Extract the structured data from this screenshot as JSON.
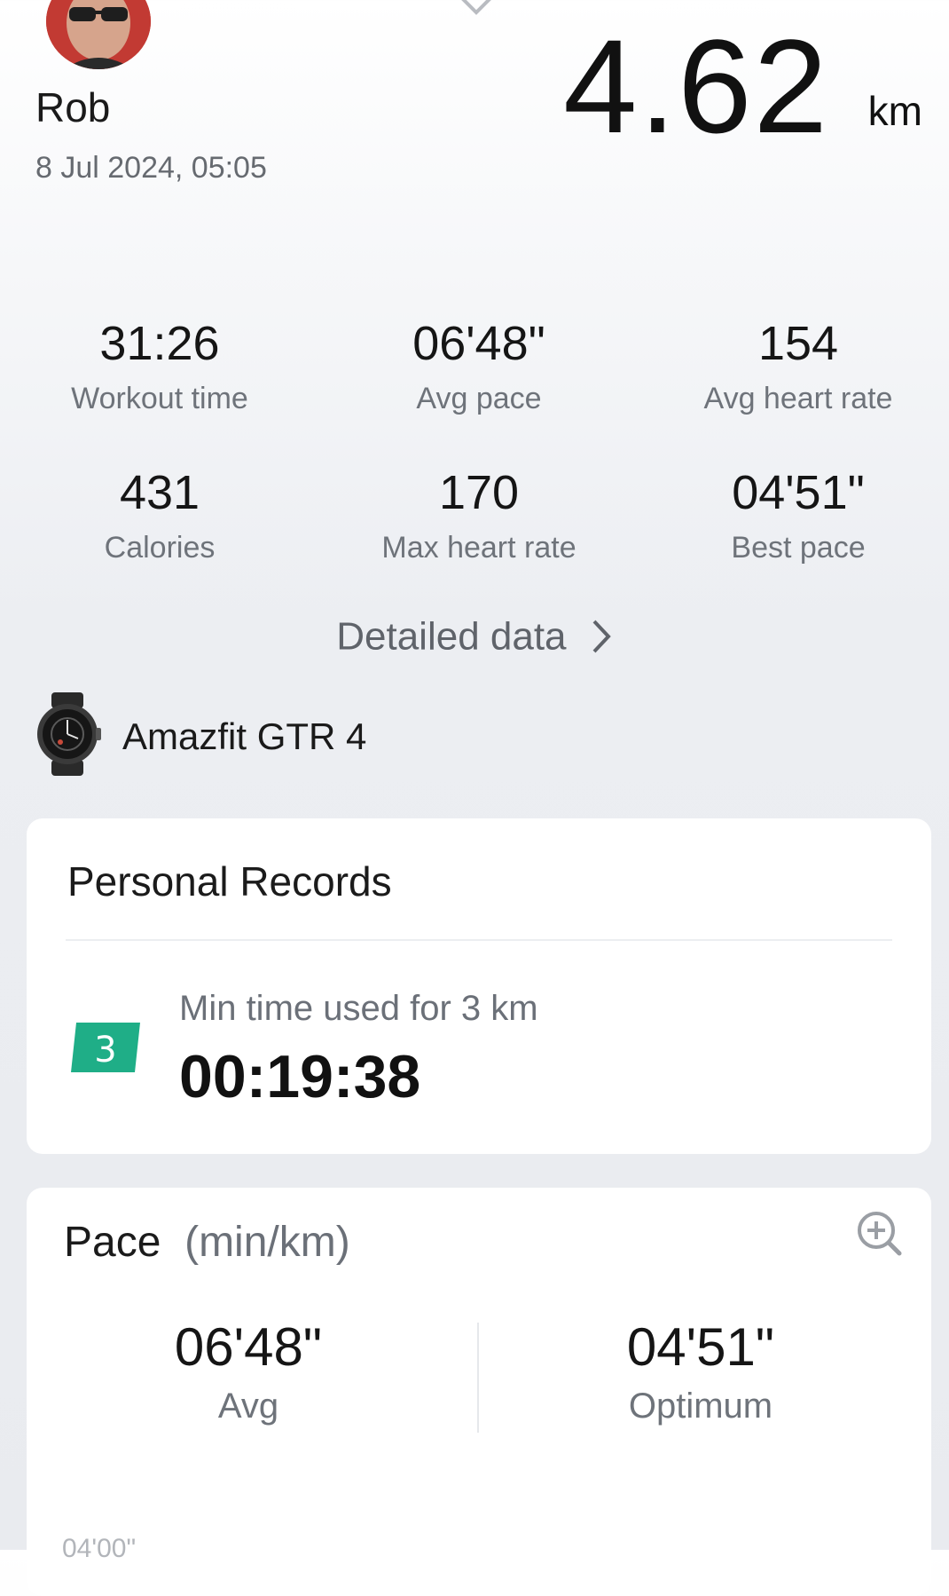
{
  "header": {
    "user_name": "Rob",
    "date": "8 Jul 2024, 05:05",
    "distance": "4.62",
    "distance_unit": "km"
  },
  "stats": [
    {
      "value": "31:26",
      "label": "Workout time"
    },
    {
      "value": "06'48\"",
      "label": "Avg pace"
    },
    {
      "value": "154",
      "label": "Avg heart rate"
    },
    {
      "value": "431",
      "label": "Calories"
    },
    {
      "value": "170",
      "label": "Max heart rate"
    },
    {
      "value": "04'51\"",
      "label": "Best pace"
    }
  ],
  "detailed_link": "Detailed data",
  "device": {
    "name": "Amazfit GTR 4"
  },
  "records": {
    "title": "Personal Records",
    "badge": "3",
    "label": "Min time used for 3 km",
    "value": "00:19:38"
  },
  "pace": {
    "title": "Pace",
    "unit": "(min/km)",
    "avg_value": "06'48\"",
    "avg_label": "Avg",
    "optimum_value": "04'51\"",
    "optimum_label": "Optimum",
    "axis_top": "04'00\""
  },
  "colors": {
    "badge": "#1fae87",
    "accent_text": "#1b1b1b"
  },
  "icons": [
    "chevron-down-icon",
    "chevron-right-icon",
    "smartwatch-icon",
    "zoom-in-icon"
  ]
}
